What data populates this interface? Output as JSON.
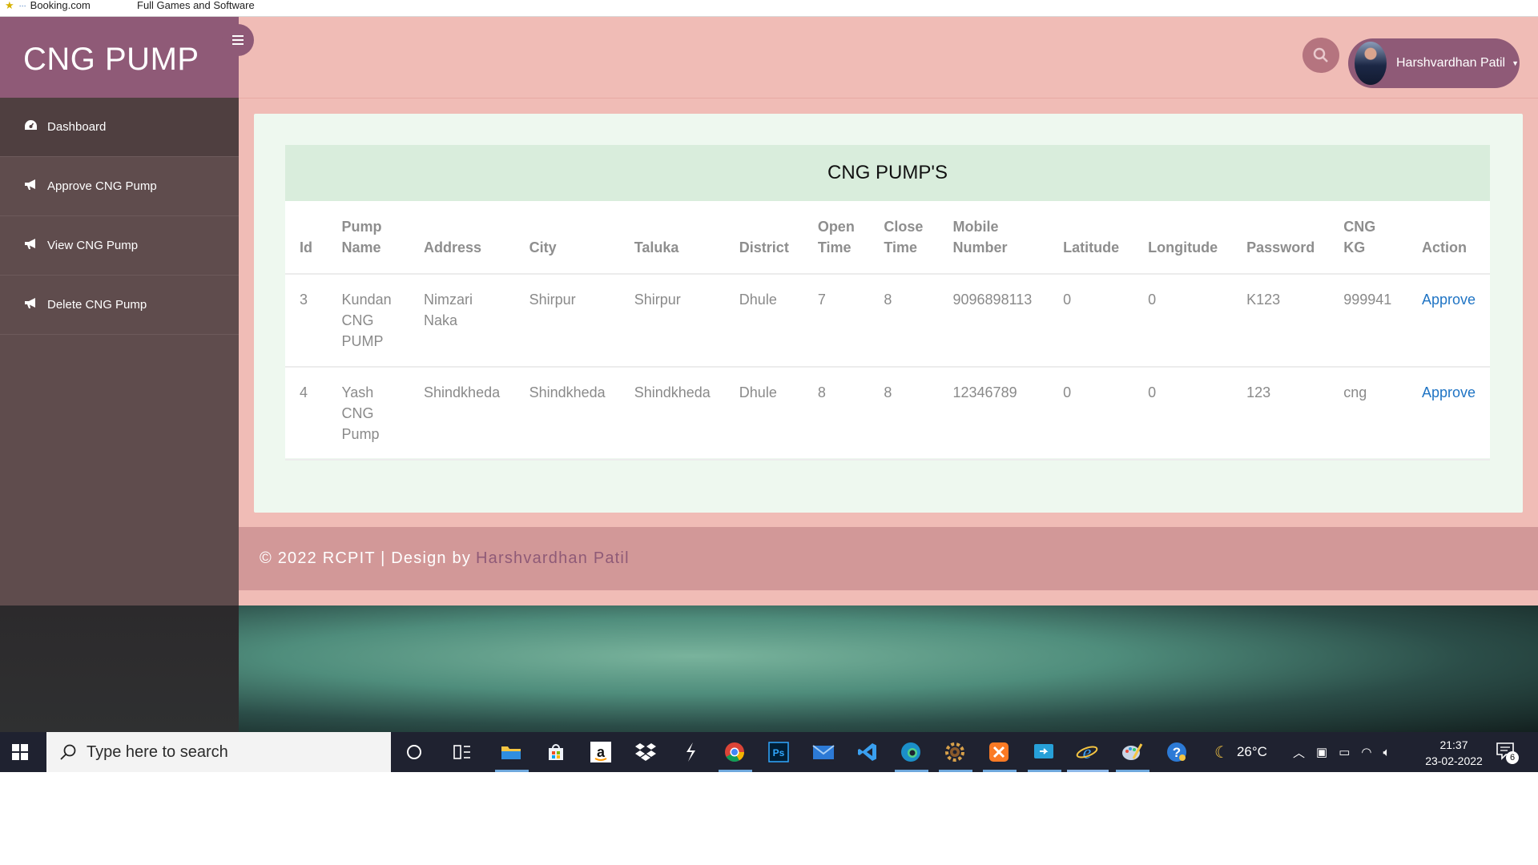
{
  "bookmarks": {
    "items": [
      "Booking.com",
      "Full Games and Software"
    ]
  },
  "sidebar": {
    "brand": "CNG PUMP",
    "items": [
      {
        "label": "Dashboard",
        "icon": "dashboard-icon"
      },
      {
        "label": "Approve CNG Pump",
        "icon": "bullhorn-icon"
      },
      {
        "label": "View CNG Pump",
        "icon": "bullhorn-icon"
      },
      {
        "label": "Delete CNG Pump",
        "icon": "bullhorn-icon"
      }
    ]
  },
  "header": {
    "user_name": "Harshvardhan Patil"
  },
  "panel": {
    "title": "CNG PUMP'S",
    "columns": [
      "Id",
      "Pump Name",
      "Address",
      "City",
      "Taluka",
      "District",
      "Open Time",
      "Close Time",
      "Mobile Number",
      "Latitude",
      "Longitude",
      "Password",
      "CNG KG",
      "Action"
    ],
    "rows": [
      [
        "3",
        "Kundan CNG PUMP",
        "Nimzari Naka",
        "Shirpur",
        "Shirpur",
        "Dhule",
        "7",
        "8",
        "9096898113",
        "0",
        "0",
        "K123",
        "999941",
        "Approve"
      ],
      [
        "4",
        "Yash CNG Pump",
        "Shindkheda",
        "Shindkheda",
        "Shindkheda",
        "Dhule",
        "8",
        "8",
        "12346789",
        "0",
        "0",
        "123",
        "cng",
        "Approve"
      ]
    ]
  },
  "footer": {
    "text": "© 2022 RCPIT | Design by",
    "author": "Harshvardhan Patil"
  },
  "taskbar": {
    "search_placeholder": "Type here to search",
    "weather": "26°C",
    "time": "21:37",
    "date": "23-02-2022",
    "notification_count": "6"
  },
  "colors": {
    "sidebar_bg": "#5f4c4d",
    "brand_bg": "#8f5a77",
    "main_bg": "#f0bcb6",
    "card_bg": "#eef8ef",
    "card_head_bg": "#d9eddc",
    "footer_bg": "#d29898",
    "link": "#1f74c4"
  }
}
